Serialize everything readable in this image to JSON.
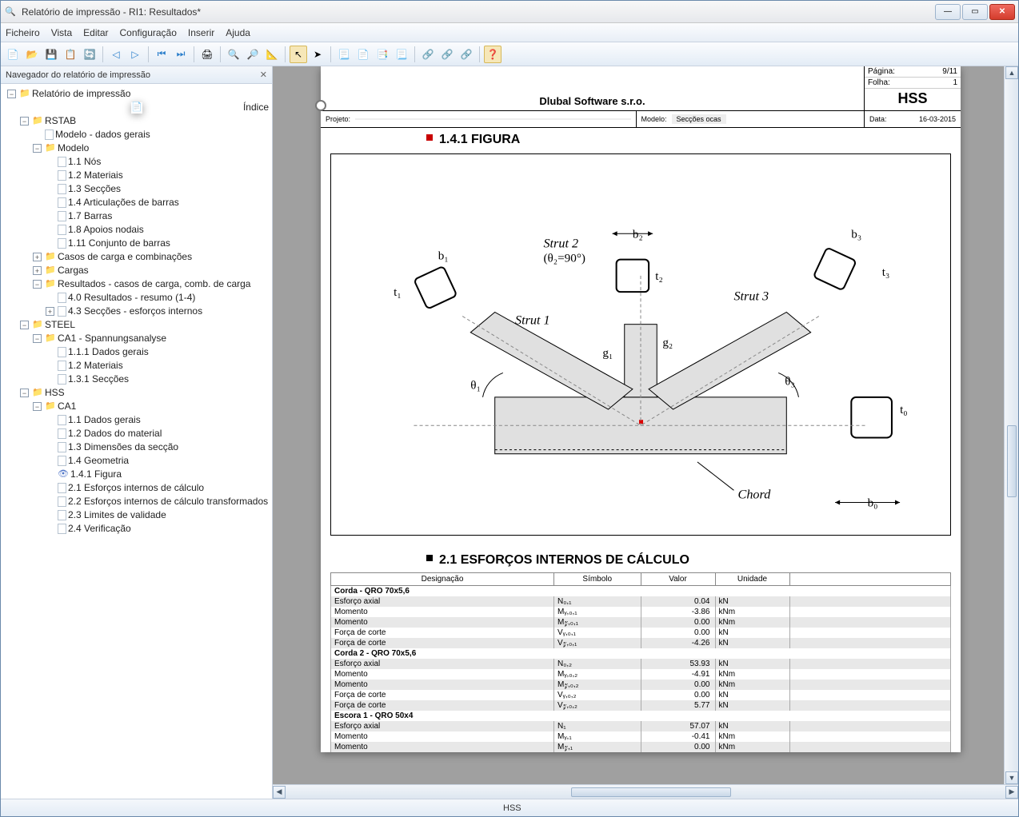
{
  "window": {
    "title": "Relatório de impressão - RI1: Resultados*"
  },
  "menu": [
    "Ficheiro",
    "Vista",
    "Editar",
    "Configuração",
    "Inserir",
    "Ajuda"
  ],
  "nav": {
    "title": "Navegador do relatório de impressão"
  },
  "tree": {
    "root": "Relatório de impressão",
    "indice": "Índice",
    "rstab": "RSTAB",
    "modelo_dados": "Modelo - dados gerais",
    "modelo": "Modelo",
    "n11": "1.1 Nós",
    "n12": "1.2 Materiais",
    "n13": "1.3 Secções",
    "n14": "1.4 Articulações de barras",
    "n17": "1.7 Barras",
    "n18": "1.8 Apoios nodais",
    "n111": "1.11 Conjunto de barras",
    "casos": "Casos de carga e combinações",
    "cargas": "Cargas",
    "result": "Resultados - casos de carga, comb. de carga",
    "r40": "4.0 Resultados - resumo (1-4)",
    "r43": "4.3 Secções - esforços internos",
    "steel": "STEEL",
    "ca1s": "CA1 - Spannungsanalyse",
    "s111": "1.1.1 Dados gerais",
    "s12": "1.2 Materiais",
    "s131": "1.3.1 Secções",
    "hss": "HSS",
    "ca1": "CA1",
    "h11": "1.1 Dados gerais",
    "h12": "1.2 Dados do material",
    "h13": "1.3 Dimensões da secção",
    "h14": "1.4 Geometria",
    "h141": "1.4.1 Figura",
    "h21": "2.1 Esforços internos de cálculo",
    "h22": "2.2 Esforços internos de cálculo transformados",
    "h23": "2.3 Limites de validade",
    "h24": "2.4 Verificação"
  },
  "page": {
    "company": "Dlubal Software s.r.o.",
    "pagina_lbl": "Página:",
    "pagina": "9/11",
    "folha_lbl": "Folha:",
    "folha": "1",
    "big": "HSS",
    "projeto_lbl": "Projeto:",
    "projeto": "",
    "modelo_lbl": "Modelo:",
    "modelo": "Secções ocas",
    "data_lbl": "Data:",
    "data": "16-03-2015",
    "section1": "1.4.1 FIGURA",
    "section2": "2.1 ESFORÇOS INTERNOS DE CÁLCULO",
    "fig": {
      "strut1": "Strut 1",
      "strut2": "Strut 2",
      "strut2b": "(θ₂=90°)",
      "strut3": "Strut 3",
      "chord": "Chord",
      "b1": "b₁",
      "t1": "t₁",
      "b2": "b₂",
      "t2": "t₂",
      "b3": "b₃",
      "t3": "t₃",
      "b0": "b₀",
      "t0": "t₀",
      "g1": "g₁",
      "g2": "g₂",
      "th1": "θ₁",
      "th3": "θ₃"
    },
    "thead": {
      "des": "Designação",
      "sym": "Símbolo",
      "val": "Valor",
      "uni": "Unidade"
    },
    "rows": [
      {
        "hdr": true,
        "des": "Corda - QRO 70x5,6"
      },
      {
        "des": "Esforço axial",
        "sym": "N₀,₁",
        "val": "0.04",
        "uni": "kN"
      },
      {
        "des": "Momento",
        "sym": "Mᵧ,₀,₁",
        "val": "-3.86",
        "uni": "kNm"
      },
      {
        "des": "Momento",
        "sym": "M𝓏,₀,₁",
        "val": "0.00",
        "uni": "kNm"
      },
      {
        "des": "Força de corte",
        "sym": "Vᵧ,₀,₁",
        "val": "0.00",
        "uni": "kN"
      },
      {
        "des": "Força de corte",
        "sym": "V𝓏,₀,₁",
        "val": "-4.26",
        "uni": "kN"
      },
      {
        "hdr": true,
        "des": "Corda 2 - QRO 70x5,6"
      },
      {
        "des": "Esforço axial",
        "sym": "N₀,₂",
        "val": "53.93",
        "uni": "kN"
      },
      {
        "des": "Momento",
        "sym": "Mᵧ,₀,₂",
        "val": "-4.91",
        "uni": "kNm"
      },
      {
        "des": "Momento",
        "sym": "M𝓏,₀,₂",
        "val": "0.00",
        "uni": "kNm"
      },
      {
        "des": "Força de corte",
        "sym": "Vᵧ,₀,₂",
        "val": "0.00",
        "uni": "kN"
      },
      {
        "des": "Força de corte",
        "sym": "V𝓏,₀,₂",
        "val": "5.77",
        "uni": "kN"
      },
      {
        "hdr": true,
        "des": "Escora 1 - QRO 50x4"
      },
      {
        "des": "Esforço axial",
        "sym": "N₁",
        "val": "57.07",
        "uni": "kN"
      },
      {
        "des": "Momento",
        "sym": "Mᵧ,₁",
        "val": "-0.41",
        "uni": "kNm"
      },
      {
        "des": "Momento",
        "sym": "M𝓏,₁",
        "val": "0.00",
        "uni": "kNm"
      }
    ]
  },
  "status": {
    "text": "HSS"
  }
}
